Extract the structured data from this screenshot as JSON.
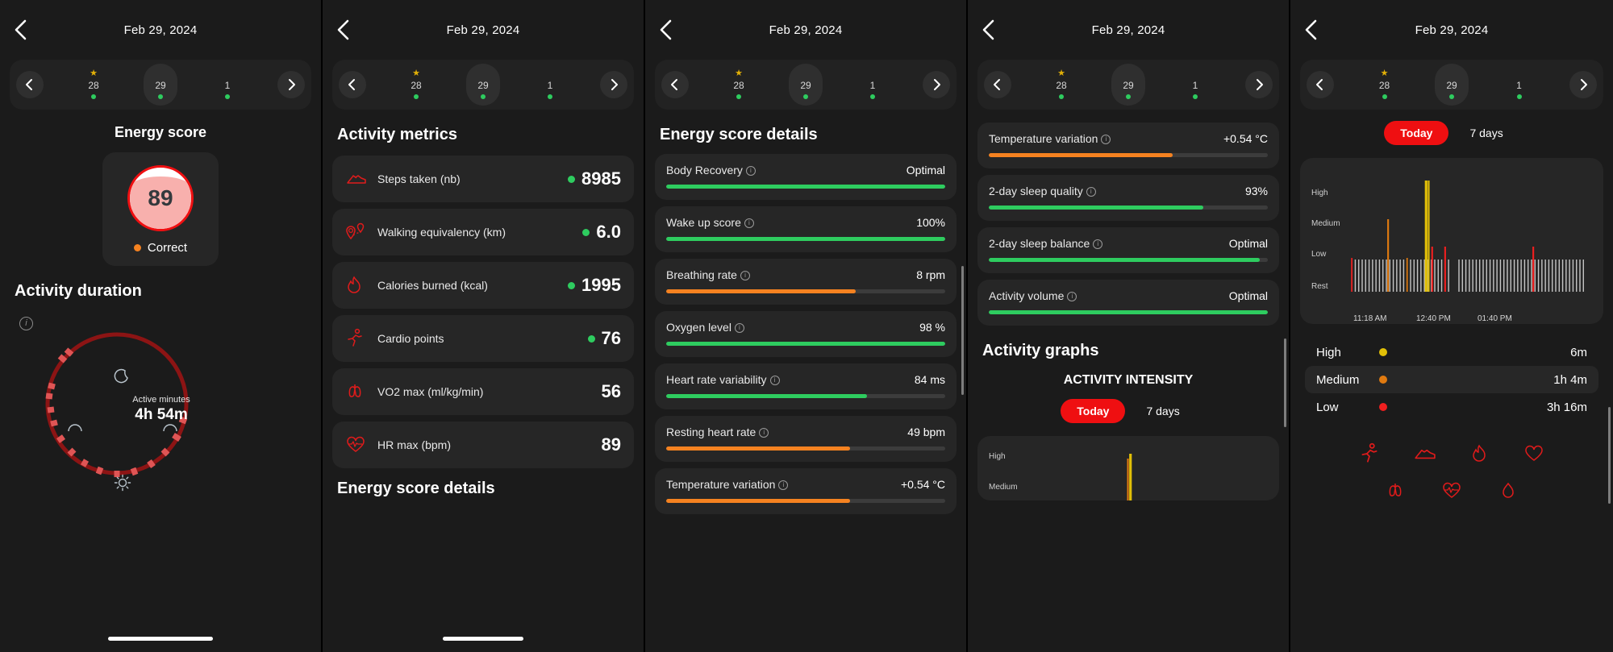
{
  "common": {
    "date": "Feb 29, 2024",
    "days": [
      {
        "num": "28",
        "star": true,
        "dot": true,
        "selected": false
      },
      {
        "num": "29",
        "star": false,
        "dot": true,
        "selected": true
      },
      {
        "num": "1",
        "star": false,
        "dot": true,
        "selected": false
      }
    ],
    "back_icon": "chevron-left-icon",
    "prev_icon": "chevron-left-icon",
    "next_icon": "chevron-right-icon",
    "colors": {
      "green": "#2ecc5f",
      "orange": "#f58220",
      "red": "#ef0f11",
      "yellow": "#e2b007",
      "card": "#262626",
      "bg": "#1b1b1b"
    }
  },
  "panel1": {
    "title": "Energy score",
    "score": "89",
    "status": "Correct",
    "duration_title": "Activity duration",
    "ring_center_label": "Active minutes",
    "ring_center_value": "4h 54m",
    "ring_icons": [
      "moon-icon",
      "sunrise-left-icon",
      "sunrise-right-icon",
      "sun-icon"
    ]
  },
  "panel2": {
    "title": "Activity metrics",
    "next_title": "Energy score details",
    "metrics": [
      {
        "icon": "shoe-icon",
        "label": "Steps taken (nb)",
        "value": "8985",
        "dot": true
      },
      {
        "icon": "route-pin-icon",
        "label": "Walking equivalency (km)",
        "value": "6.0",
        "dot": true
      },
      {
        "icon": "flame-icon",
        "label": "Calories burned (kcal)",
        "value": "1995",
        "dot": true
      },
      {
        "icon": "runner-icon",
        "label": "Cardio points",
        "value": "76",
        "dot": true
      },
      {
        "icon": "lungs-icon",
        "label": "VO2 max (ml/kg/min)",
        "value": "56",
        "dot": false
      },
      {
        "icon": "heart-rate-icon",
        "label": "HR max (bpm)",
        "value": "89",
        "dot": false
      }
    ]
  },
  "panel3": {
    "title": "Energy score details",
    "rows": [
      {
        "label": "Body Recovery",
        "info": true,
        "value": "Optimal",
        "pct": 100,
        "color": "#2ecc5f"
      },
      {
        "label": "Wake up score",
        "info": true,
        "value": "100%",
        "pct": 100,
        "color": "#2ecc5f"
      },
      {
        "label": "Breathing rate",
        "info": true,
        "value": "8 rpm",
        "pct": 68,
        "color": "#f58220"
      },
      {
        "label": "Oxygen level",
        "info": true,
        "value": "98 %",
        "pct": 100,
        "color": "#2ecc5f"
      },
      {
        "label": "Heart rate variability",
        "info": true,
        "value": "84 ms",
        "pct": 72,
        "color": "#2ecc5f"
      },
      {
        "label": "Resting heart rate",
        "info": true,
        "value": "49 bpm",
        "pct": 66,
        "color": "#f58220"
      },
      {
        "label": "Temperature variation",
        "info": true,
        "value": "+0.54 °C",
        "pct": 66,
        "color": "#f58220"
      }
    ]
  },
  "panel4": {
    "rows": [
      {
        "label": "Temperature variation",
        "info": true,
        "value": "+0.54 °C",
        "pct": 66,
        "color": "#f58220"
      },
      {
        "label": "2-day sleep quality",
        "info": true,
        "value": "93%",
        "pct": 77,
        "color": "#2ecc5f"
      },
      {
        "label": "2-day sleep balance",
        "info": true,
        "value": "Optimal",
        "pct": 97,
        "color": "#2ecc5f"
      },
      {
        "label": "Activity volume",
        "info": true,
        "value": "Optimal",
        "pct": 100,
        "color": "#2ecc5f"
      }
    ],
    "graphs_title": "Activity graphs",
    "chart_title": "ACTIVITY INTENSITY",
    "tabs": [
      {
        "label": "Today",
        "active": true
      },
      {
        "label": "7 days",
        "active": false
      }
    ],
    "mini_y": [
      "High",
      "Medium"
    ]
  },
  "panel5": {
    "tabs": [
      {
        "label": "Today",
        "active": true
      },
      {
        "label": "7 days",
        "active": false
      }
    ],
    "legend": [
      {
        "name": "High",
        "time": "6m",
        "color": "#e2c007",
        "highlight": false
      },
      {
        "name": "Medium",
        "time": "1h 4m",
        "color": "#e07a10",
        "highlight": true
      },
      {
        "name": "Low",
        "time": "3h 16m",
        "color": "#ef1f1f",
        "highlight": false
      }
    ],
    "icon_row_1": [
      "runner-icon",
      "shoe-icon",
      "flame-icon",
      "heart-outline-icon"
    ],
    "icon_row_2": [
      "lungs-icon",
      "heart-rate-icon",
      "drop-icon"
    ]
  },
  "chart_data": {
    "type": "bar",
    "title": "ACTIVITY INTENSITY",
    "xlabel": "",
    "ylabel": "",
    "ytick_labels": [
      "High",
      "Medium",
      "Low",
      "Rest"
    ],
    "xtick_labels": [
      "11:18 AM",
      "12:40 PM",
      "01:40 PM"
    ],
    "grid": false,
    "legend_position": "below",
    "series": [
      {
        "name": "Rest",
        "color": "#c6c6c6",
        "values_note": "dense light grey baseline bars spanning full range"
      },
      {
        "name": "Low",
        "color": "#ef1f1f",
        "values": [
          {
            "x": "12:47 PM",
            "level": "Low"
          },
          {
            "x": "12:55 PM",
            "level": "Low"
          },
          {
            "x": "01:58 PM",
            "level": "Low"
          }
        ]
      },
      {
        "name": "Medium",
        "color": "#e07a10",
        "values": [
          {
            "x": "11:36 AM",
            "level": "Medium"
          }
        ]
      },
      {
        "name": "High",
        "color": "#e2c007",
        "values": [
          {
            "x": "12:38 PM",
            "level": "High"
          }
        ]
      }
    ],
    "totals": {
      "High": "6m",
      "Medium": "1h 4m",
      "Low": "3h 16m"
    }
  }
}
